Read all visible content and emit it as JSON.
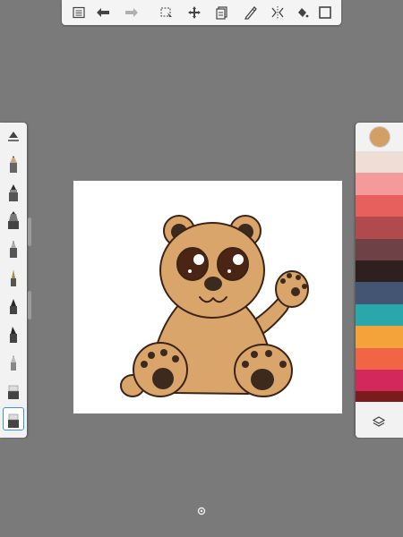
{
  "toolbar": {
    "buttons": [
      {
        "name": "menu-button",
        "icon": "list-icon"
      },
      {
        "name": "undo-button",
        "icon": "undo-arrow-icon"
      },
      {
        "name": "redo-button",
        "icon": "redo-arrow-icon"
      },
      {
        "name": "selection-button",
        "icon": "selection-icon"
      },
      {
        "name": "transform-button",
        "icon": "move-arrows-icon"
      },
      {
        "name": "layers-copy-button",
        "icon": "stack-icon"
      },
      {
        "name": "ruler-button",
        "icon": "ruler-pencil-icon"
      },
      {
        "name": "symmetry-button",
        "icon": "symmetry-icon"
      },
      {
        "name": "fill-button",
        "icon": "bucket-icon"
      },
      {
        "name": "fullscreen-button",
        "icon": "frame-icon"
      }
    ]
  },
  "brushes": {
    "items": [
      {
        "name": "brush-properties",
        "icon": "triangle-icon"
      },
      {
        "name": "pencil",
        "icon": "pencil-icon",
        "tip": "#3a2a24"
      },
      {
        "name": "ballpoint",
        "icon": "pen-icon",
        "tip": "#303030"
      },
      {
        "name": "marker",
        "icon": "marker-icon",
        "tip": "#2e2e2e"
      },
      {
        "name": "fineliner",
        "icon": "fineliner-icon",
        "tip": "#6f6f6f"
      },
      {
        "name": "paintbrush",
        "icon": "paintbrush-icon",
        "tip": "#b08a40"
      },
      {
        "name": "airbrush",
        "icon": "airbrush-icon",
        "tip": "#2b2420"
      },
      {
        "name": "chisel-marker",
        "icon": "chisel-marker-icon",
        "tip": "#2b2420"
      },
      {
        "name": "soft-pencil",
        "icon": "soft-pencil-icon",
        "tip": "#9a9a9a"
      },
      {
        "name": "eraser-hard",
        "icon": "eraser-icon",
        "tip": "#dddddd"
      },
      {
        "name": "eraser-soft",
        "icon": "eraser-icon",
        "tip": "#dddddd",
        "selected": true
      }
    ]
  },
  "colors": {
    "current": "#d2a066",
    "swatches": [
      "#efded6",
      "#f49a9a",
      "#e8605d",
      "#b04a4c",
      "#6d4146",
      "#2e201f",
      "#435573",
      "#2aa7ab",
      "#f4a33a",
      "#f26544",
      "#d2285c",
      "#7a1c1c"
    ]
  },
  "canvas": {
    "drawing": "bear-drawing",
    "colors": {
      "fur": "#d9a56a",
      "outline": "#3b2416",
      "dark": "#3d2a1f",
      "eye": "#4a2414",
      "highlight": "#ffffff"
    }
  }
}
